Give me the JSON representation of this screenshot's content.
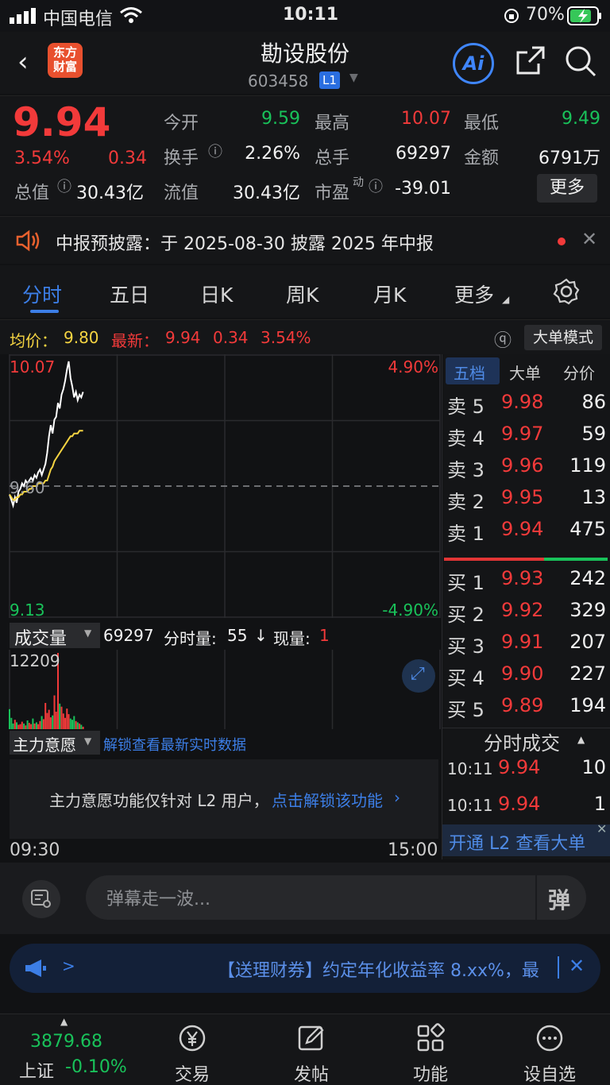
{
  "status_bar": {
    "carrier": "中国电信",
    "time": "10:11",
    "battery": "70%"
  },
  "header": {
    "logo_line1": "东方",
    "logo_line2": "财富",
    "stock_name": "勘设股份",
    "stock_code": "603458",
    "level": "L1",
    "ai_label": "Ai"
  },
  "quote": {
    "price": "9.94",
    "change_pct": "3.54%",
    "change_val": "0.34",
    "open_label": "今开",
    "open": "9.59",
    "high_label": "最高",
    "high": "10.07",
    "low_label": "最低",
    "low": "9.49",
    "turnover_label": "换手",
    "turnover": "2.26%",
    "volume_label": "总手",
    "volume": "69297",
    "amount_label": "金额",
    "amount": "6791万",
    "mktcap_label": "总值",
    "mktcap": "30.43亿",
    "float_label": "流值",
    "float_cap": "30.43亿",
    "pe_label": "市盈",
    "pe_sup": "动",
    "pe": "-39.01",
    "more_label": "更多"
  },
  "notice": {
    "text": "中报预披露：于 2025-08-30 披露 2025 年中报"
  },
  "tabs": [
    {
      "label": "分时"
    },
    {
      "label": "五日"
    },
    {
      "label": "日K"
    },
    {
      "label": "周K"
    },
    {
      "label": "月K"
    },
    {
      "label": "更多"
    }
  ],
  "strip": {
    "avg_label": "均价：",
    "avg": "9.80",
    "latest_label": "最新：",
    "latest": "9.94",
    "latest_chg": "0.34",
    "latest_pct": "3.54%",
    "big_order_label": "大单模式"
  },
  "chart": {
    "price_top": "10.07",
    "price_bottom": "9.13",
    "price_mid": "9.60",
    "pct_top": "4.90%",
    "pct_bottom": "-4.90%",
    "vol_selector": "成交量",
    "vol_total": "69297",
    "vol_minute_label": "分时量:",
    "vol_minute": "55",
    "vol_now_label": "现量:",
    "vol_now": "1",
    "vol_max": "12209",
    "main_selector": "主力意愿",
    "main_unlock_link": "解锁查看最新实时数据",
    "main_msg": "主力意愿功能仅针对 L2 用户，",
    "main_msg_link": "点击解锁该功能",
    "time_start": "09:30",
    "time_end": "15:00",
    "chart_data": {
      "type": "line",
      "series": [
        {
          "x": [
            "09:30",
            "09:31",
            "09:32",
            "09:33",
            "09:34",
            "09:35",
            "09:36",
            "09:37",
            "09:38",
            "09:39",
            "09:40",
            "09:41",
            "09:42",
            "09:43",
            "09:44",
            "09:45",
            "09:46",
            "09:47",
            "09:48",
            "09:49",
            "09:50",
            "09:51",
            "09:52",
            "09:53",
            "09:54",
            "09:55",
            "09:56",
            "09:57",
            "09:58",
            "09:59",
            "10:00",
            "10:01",
            "10:02",
            "10:03",
            "10:04",
            "10:05",
            "10:06",
            "10:07",
            "10:08",
            "10:09",
            "10:10",
            "10:11"
          ],
          "values": [
            9.57,
            9.55,
            9.53,
            9.56,
            9.54,
            9.58,
            9.59,
            9.61,
            9.6,
            9.62,
            9.61,
            9.62,
            9.63,
            9.62,
            9.64,
            9.63,
            9.65,
            9.66,
            9.64,
            9.66,
            9.68,
            9.72,
            9.78,
            9.82,
            9.79,
            9.84,
            9.85,
            9.9,
            9.88,
            9.93,
            9.95,
            9.98,
            10.02,
            10.05,
            9.99,
            9.96,
            9.92,
            9.94,
            9.91,
            9.93,
            9.92,
            9.94
          ]
        },
        {
          "x": [
            "09:30",
            "09:31",
            "09:32",
            "09:33",
            "09:34",
            "09:35",
            "09:36",
            "09:37",
            "09:38",
            "09:39",
            "09:40",
            "09:41",
            "09:42",
            "09:43",
            "09:44",
            "09:45",
            "09:46",
            "09:47",
            "09:48",
            "09:49",
            "09:50",
            "09:51",
            "09:52",
            "09:53",
            "09:54",
            "09:55",
            "09:56",
            "09:57",
            "09:58",
            "09:59",
            "10:00",
            "10:01",
            "10:02",
            "10:03",
            "10:04",
            "10:05",
            "10:06",
            "10:07",
            "10:08",
            "10:09",
            "10:10",
            "10:11"
          ],
          "values": [
            9.57,
            9.56,
            9.55,
            9.55,
            9.56,
            9.56,
            9.57,
            9.57,
            9.58,
            9.58,
            9.58,
            9.59,
            9.59,
            9.6,
            9.6,
            9.6,
            9.61,
            9.61,
            9.61,
            9.61,
            9.62,
            9.62,
            9.64,
            9.66,
            9.67,
            9.69,
            9.7,
            9.71,
            9.72,
            9.73,
            9.74,
            9.75,
            9.76,
            9.77,
            9.78,
            9.78,
            9.79,
            9.79,
            9.79,
            9.8,
            9.8,
            9.8
          ]
        }
      ],
      "ylim": [
        9.13,
        10.07
      ],
      "volume": [
        3200,
        1800,
        900,
        1500,
        1100,
        700,
        800,
        1200,
        900,
        600,
        1400,
        1000,
        800,
        1700,
        900,
        1100,
        800,
        1300,
        2100,
        1600,
        4200,
        2600,
        3100,
        1900,
        2200,
        5400,
        2800,
        12209,
        4100,
        3600,
        2500,
        1800,
        3300,
        2400,
        1700,
        1500,
        2100,
        1300,
        1100,
        900,
        700,
        400
      ]
    }
  },
  "order_book": {
    "tabs": [
      "五档",
      "大单",
      "分价"
    ],
    "asks": [
      {
        "label": "卖 5",
        "price": "9.98",
        "vol": "86"
      },
      {
        "label": "卖 4",
        "price": "9.97",
        "vol": "59"
      },
      {
        "label": "卖 3",
        "price": "9.96",
        "vol": "119"
      },
      {
        "label": "卖 2",
        "price": "9.95",
        "vol": "13"
      },
      {
        "label": "卖 1",
        "price": "9.94",
        "vol": "475"
      }
    ],
    "bids": [
      {
        "label": "买 1",
        "price": "9.93",
        "vol": "242"
      },
      {
        "label": "买 2",
        "price": "9.92",
        "vol": "329"
      },
      {
        "label": "买 3",
        "price": "9.91",
        "vol": "207"
      },
      {
        "label": "买 4",
        "price": "9.90",
        "vol": "227"
      },
      {
        "label": "买 5",
        "price": "9.89",
        "vol": "194"
      }
    ],
    "trades_title": "分时成交",
    "trades": [
      {
        "time": "10:11",
        "price": "9.94",
        "vol": "10"
      },
      {
        "time": "10:11",
        "price": "9.94",
        "vol": "1"
      }
    ],
    "l2_banner": "开通 L2 查看大单"
  },
  "danmu": {
    "placeholder": "弹幕走一波...",
    "danmu_btn": "弹"
  },
  "promo": {
    "arrow": ">",
    "text": "【送理财券】约定年化收益率 8.xx%，最"
  },
  "bottom_nav": {
    "index_value": "3879.68",
    "index_name": "上证",
    "index_chg": "-0.10%",
    "items": [
      {
        "label": "交易"
      },
      {
        "label": "发帖"
      },
      {
        "label": "功能"
      },
      {
        "label": "设自选"
      }
    ]
  },
  "colors": {
    "up": "#f23a3a",
    "down": "#19c25a",
    "accent": "#3c7ee6",
    "avg_line": "#f5d442"
  }
}
